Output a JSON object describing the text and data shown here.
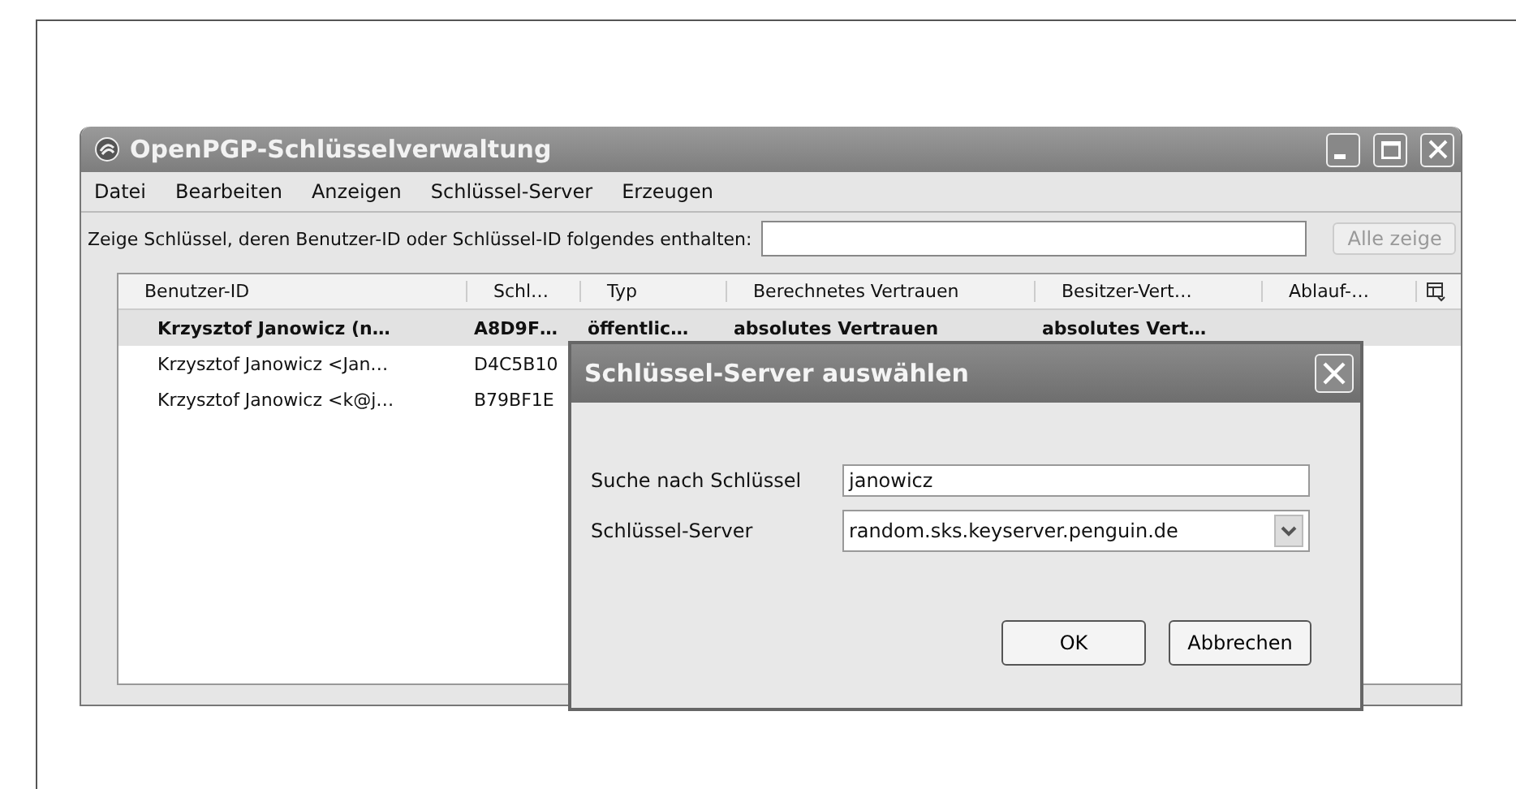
{
  "window": {
    "title": "OpenPGP-Schlüsselverwaltung"
  },
  "menu": [
    "Datei",
    "Bearbeiten",
    "Anzeigen",
    "Schlüssel-Server",
    "Erzeugen"
  ],
  "filter": {
    "label": "Zeige Schlüssel, deren Benutzer-ID oder Schlüssel-ID folgendes enthalten:",
    "button": "Alle zeige"
  },
  "table": {
    "columns": [
      "Benutzer-ID",
      "Schl…",
      "Typ",
      "Berechnetes Vertrauen",
      "Besitzer-Vert…",
      "Ablauf-…"
    ],
    "rows": [
      {
        "selected": true,
        "cells": [
          "Krzysztof Janowicz (n…",
          "A8D9F…",
          "öffentlic…",
          "absolutes Vertrauen",
          "absolutes Vert…"
        ]
      },
      {
        "selected": false,
        "cells": [
          "Krzysztof Janowicz <Jan…",
          "D4C5B10"
        ]
      },
      {
        "selected": false,
        "cells": [
          "Krzysztof Janowicz <k@j…",
          "B79BF1E"
        ]
      }
    ]
  },
  "dialog": {
    "title": "Schlüssel-Server auswählen",
    "fields": [
      {
        "kind": "text",
        "label": "Suche nach Schlüssel",
        "value": "janowicz"
      },
      {
        "kind": "select",
        "label": "Schlüssel-Server",
        "value": "random.sks.keyserver.penguin.de"
      }
    ],
    "buttons": [
      "OK",
      "Abbrechen"
    ]
  }
}
